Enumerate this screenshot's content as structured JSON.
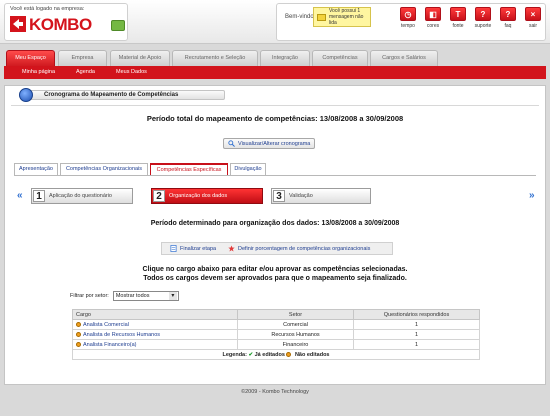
{
  "header": {
    "company_caption": "Você está logado na empresa:",
    "logo_text": "KOMBO",
    "welcome": "Bem-vindo",
    "message": "Você possui 1 mensagem não lida",
    "quick_links": [
      {
        "label": "tempo",
        "icon": "clock-icon",
        "glyph": "◷"
      },
      {
        "label": "cores",
        "icon": "palette-icon",
        "glyph": "◧"
      },
      {
        "label": "fonte",
        "icon": "font-icon",
        "glyph": "T"
      },
      {
        "label": "suporte",
        "icon": "support-icon",
        "glyph": "?"
      },
      {
        "label": "faq",
        "icon": "faq-icon",
        "glyph": "?"
      },
      {
        "label": "sair",
        "icon": "logout-icon",
        "glyph": "×"
      }
    ]
  },
  "main_nav": [
    "Meu Espaço",
    "Empresa",
    "Material de Apoio",
    "Recrutamento e Seleção",
    "Integração",
    "Competências",
    "Cargos e Salários"
  ],
  "sub_nav": [
    "Minha página",
    "Agenda",
    "Meus Dados"
  ],
  "panel": {
    "title": "Cronograma do Mapeamento de Competências",
    "total_period": "Período total do mapeamento de competências: 13/08/2008 a 30/09/2008",
    "view_button": "Visualizar/Alterar cronograma",
    "tabs": [
      "Apresentação",
      "Competências Organizacionais",
      "Competências Específicas",
      "Divulgação"
    ],
    "steps": [
      {
        "num": "1",
        "label": "Aplicação do questionário"
      },
      {
        "num": "2",
        "label": "Organização dos dados"
      },
      {
        "num": "3",
        "label": "Validação"
      }
    ],
    "step_period": "Período determinado para organização dos dados: 13/08/2008 a 30/09/2008",
    "finalize_button": "Finalizar etapa",
    "percent_button": "Definir porcentagem de competências organizacionais",
    "instruction_line1": "Clique no cargo abaixo para editar e/ou aprovar as competências selecionadas.",
    "instruction_line2": "Todos os cargos devem ser aprovados para que o mapeamento seja finalizado.",
    "filter_label": "Filtrar por setor:",
    "filter_value": "Mostrar todos"
  },
  "table": {
    "headers": [
      "Cargo",
      "Setor",
      "Questionários respondidos"
    ],
    "rows": [
      {
        "cargo": "Analista Comercial",
        "setor": "Comercial",
        "respondidos": "1"
      },
      {
        "cargo": "Analista de Recursos Humanos",
        "setor": "Recursos Humanos",
        "respondidos": "1"
      },
      {
        "cargo": "Analista Financeiro(a)",
        "setor": "Financeiro",
        "respondidos": "1"
      }
    ],
    "legend_label": "Legenda:",
    "legend_ok": "Já editados",
    "legend_no": "Não editados"
  },
  "footer": "©2009 - Kombo Technology",
  "colors": {
    "brand_red": "#d2141c",
    "link_blue": "#1d3c8f"
  }
}
